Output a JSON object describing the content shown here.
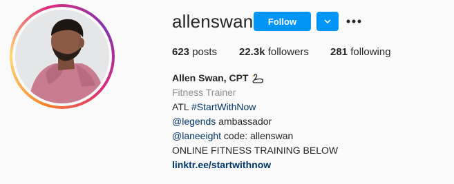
{
  "profile": {
    "username": "allenswan",
    "follow_label": "Follow",
    "icons": {
      "dropdown": "chevron-down-icon",
      "more": "more-options-icon",
      "name_emoji": "swan-icon"
    }
  },
  "stats": {
    "posts_count": "623",
    "posts_label": "posts",
    "followers_count": "22.3k",
    "followers_label": "followers",
    "following_count": "281",
    "following_label": "following"
  },
  "bio": {
    "full_name": "Allen Swan, CPT",
    "category": "Fitness Trainer",
    "line1_prefix": "ATL ",
    "line1_hashtag": "#StartWithNow",
    "line2_mention": "@legends",
    "line2_suffix": " ambassador",
    "line3_mention": "@laneeight",
    "line3_suffix": " code: allenswan",
    "line4": "ONLINE FITNESS TRAINING BELOW",
    "link": "linktr.ee/startwithnow"
  },
  "colors": {
    "accent": "#0095f6",
    "link": "#00376b",
    "secondary_text": "#8e8e8e"
  }
}
